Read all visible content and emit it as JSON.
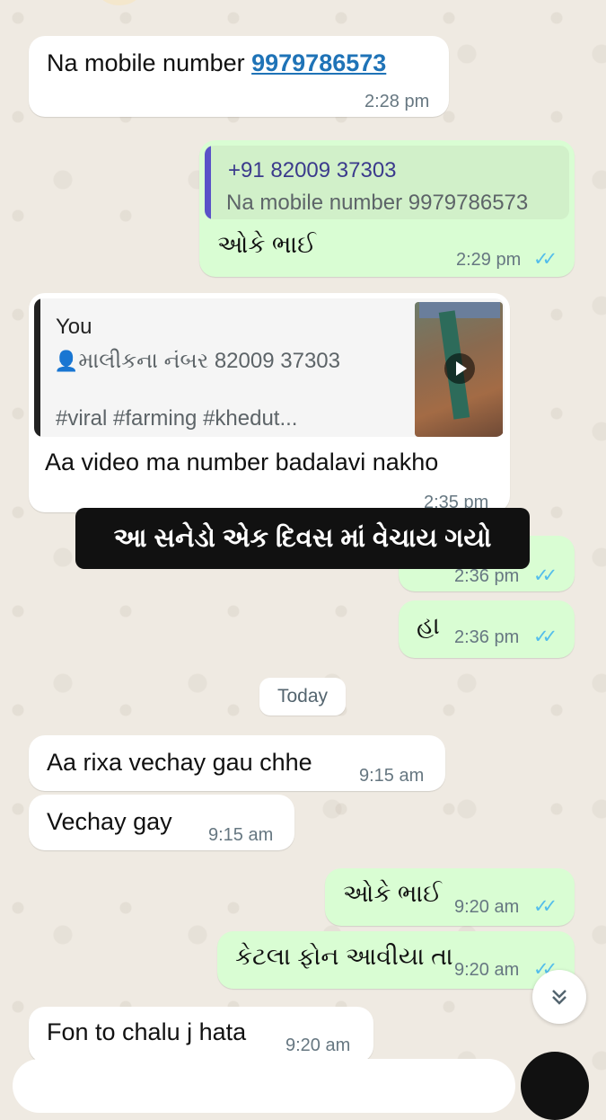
{
  "messages": {
    "m1": {
      "text": "Na mobile number ",
      "link": "9979786573",
      "time": "2:28 pm"
    },
    "m2": {
      "quote_title": "+91 82009 37303",
      "quote_body": "Na mobile number 9979786573",
      "text": "ઓકે ભાઈ",
      "time": "2:29 pm",
      "ticks": "✓✓"
    },
    "m3": {
      "quote_title": "You",
      "quote_line1": "માલીકના નંબર 82009 37303",
      "quote_line2": "#viral #farming #khedut...",
      "text": "Aa video ma number badalavi nakho",
      "time": "2:35 pm"
    },
    "m4": {
      "time": "2:36 pm",
      "ticks": "✓✓"
    },
    "m5": {
      "text": "હા",
      "time": "2:36 pm",
      "ticks": "✓✓"
    },
    "m6": {
      "text": "Aa rixa vechay gau chhe",
      "time": "9:15 am"
    },
    "m7": {
      "text": "Vechay gay",
      "time": "9:15 am"
    },
    "m8": {
      "text": "ઓકે ભાઈ",
      "time": "9:20 am",
      "ticks": "✓✓"
    },
    "m9": {
      "text": "કેટલા ફોન આવીયા તા",
      "time": "9:20 am",
      "ticks": "✓✓"
    },
    "m10": {
      "text": "Fon to chalu j hata",
      "time": "9:20 am"
    }
  },
  "banner": {
    "text": "આ સનેડો એક દિવસ માં વેચાય ગયો"
  },
  "date_divider": {
    "label": "Today"
  },
  "icons": {
    "scroll_down": "double-chevron-down-icon",
    "avatar": "person-icon",
    "play": "play-icon",
    "mic": "mic-icon"
  },
  "colors": {
    "background": "#efeae2",
    "incoming": "#ffffff",
    "outgoing": "#d9fdd3",
    "read_ticks": "#53bdeb",
    "link": "#1f73b7"
  }
}
